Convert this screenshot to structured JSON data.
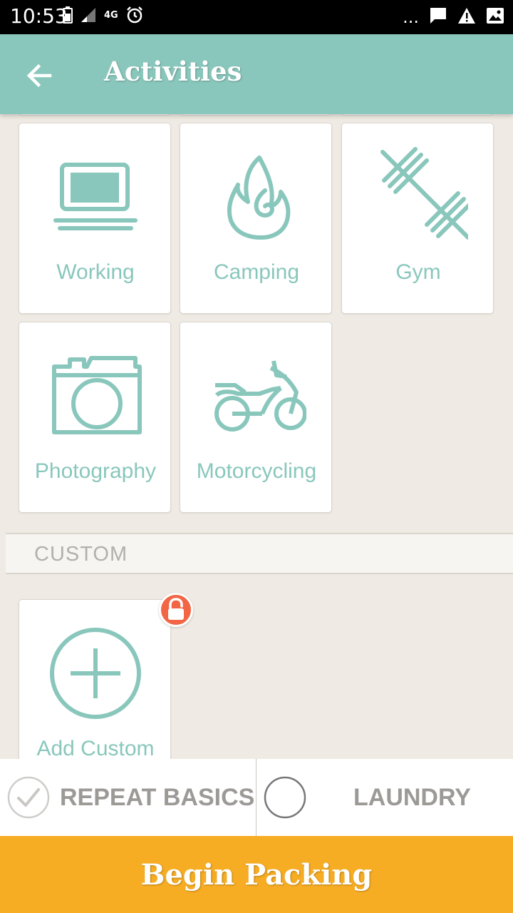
{
  "status_bar": {
    "time": "10:53",
    "network": "4G",
    "overflow": "..."
  },
  "app_bar": {
    "title": "Activities",
    "back_icon": "arrow-left-icon"
  },
  "activities": [
    {
      "label": "Working",
      "icon": "laptop-icon"
    },
    {
      "label": "Camping",
      "icon": "flame-icon"
    },
    {
      "label": "Gym",
      "icon": "barbell-icon"
    },
    {
      "label": "Photography",
      "icon": "camera-icon"
    },
    {
      "label": "Motorcycling",
      "icon": "motorcycle-icon"
    }
  ],
  "custom_section": {
    "title": "CUSTOM",
    "add_label": "Add Custom",
    "add_icon": "plus-circle-icon",
    "badge_icon": "unlock-icon"
  },
  "options": {
    "repeat_basics": {
      "label": "REPEAT BASICS",
      "checked": true
    },
    "laundry": {
      "label": "LAUNDRY",
      "checked": false
    }
  },
  "begin_button": {
    "label": "Begin Packing"
  },
  "colors": {
    "primary": "#89c7bc",
    "accent": "#f7ad23",
    "badge": "#f26645",
    "background": "#efebe4"
  }
}
